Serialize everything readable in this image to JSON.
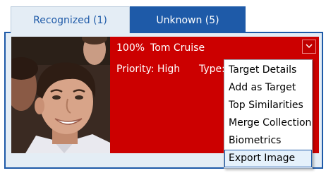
{
  "tabs": [
    {
      "label": "Recognized (1)",
      "active": true
    },
    {
      "label": "Unknown (5)",
      "active": false
    }
  ],
  "card": {
    "score": "100%",
    "name": "Tom Cruise",
    "priority": "Priority: High",
    "type_partial": "Type:",
    "background_color": "#cc0000",
    "dropdown_icon": "chevron-down-icon"
  },
  "context_menu": {
    "items": [
      {
        "label": "Target Details"
      },
      {
        "label": "Add as Target"
      },
      {
        "label": "Top Similarities"
      },
      {
        "label": "Merge Collection"
      },
      {
        "label": "Biometrics"
      },
      {
        "label": "Export Image"
      }
    ],
    "highlighted_index": 5
  },
  "colors": {
    "accent": "#1e5aa8",
    "panel_bg": "#e4edf5",
    "card_bg": "#cc0000"
  }
}
